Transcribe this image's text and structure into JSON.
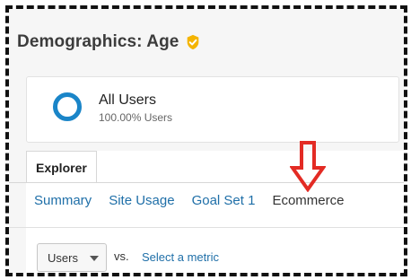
{
  "header": {
    "title": "Demographics: Age",
    "badge_icon": "verified-badge-icon",
    "badge_color": "#f4b400"
  },
  "segment": {
    "name": "All Users",
    "subtitle": "100.00% Users",
    "ring_color": "#1a85c8"
  },
  "tabs": {
    "active_label": "Explorer"
  },
  "subnav": {
    "items": [
      {
        "label": "Summary"
      },
      {
        "label": "Site Usage"
      },
      {
        "label": "Goal Set 1"
      },
      {
        "label": "Ecommerce"
      }
    ],
    "highlight_icon": "down-arrow-icon",
    "highlight_color": "#e32b24"
  },
  "metrics": {
    "primary": "Users",
    "vs_label": "vs.",
    "secondary_placeholder": "Select a metric"
  }
}
